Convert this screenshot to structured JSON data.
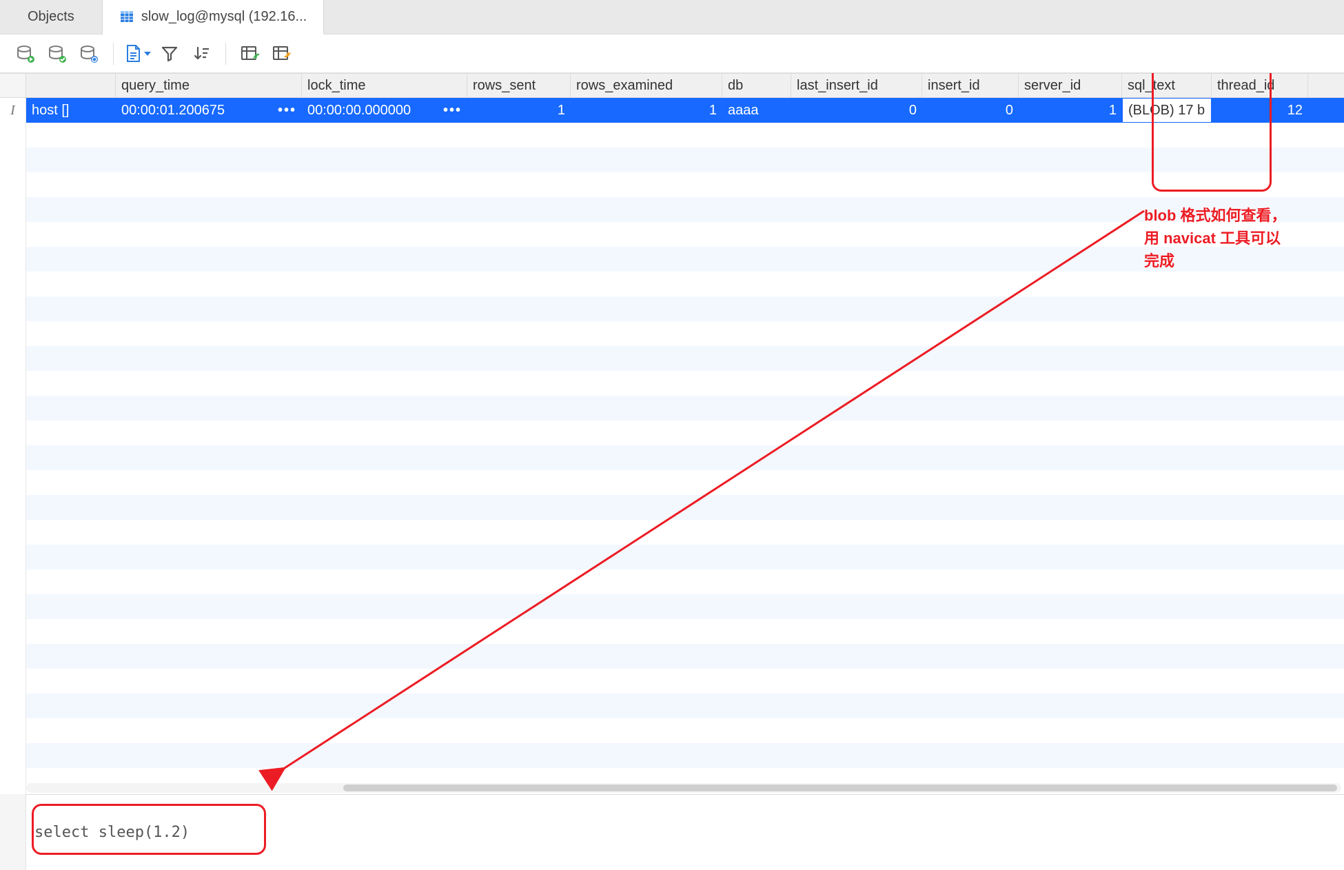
{
  "tabs": [
    {
      "label": "Objects"
    },
    {
      "label": "slow_log@mysql (192.16..."
    }
  ],
  "toolbar_icons": [
    "db-play-icon",
    "db-check-icon",
    "db-refresh-icon",
    "sep",
    "doc-icon",
    "filter-icon",
    "sort-icon",
    "sep",
    "table-import-icon",
    "table-export-icon"
  ],
  "columns": [
    {
      "key": "user_host",
      "label": "",
      "cls": "c-usr"
    },
    {
      "key": "query_time",
      "label": "query_time",
      "cls": "c-qt"
    },
    {
      "key": "lock_time",
      "label": "lock_time",
      "cls": "c-lt"
    },
    {
      "key": "rows_sent",
      "label": "rows_sent",
      "cls": "c-rs"
    },
    {
      "key": "rows_examined",
      "label": "rows_examined",
      "cls": "c-re"
    },
    {
      "key": "db",
      "label": "db",
      "cls": "c-db"
    },
    {
      "key": "last_insert_id",
      "label": "last_insert_id",
      "cls": "c-li"
    },
    {
      "key": "insert_id",
      "label": "insert_id",
      "cls": "c-ii"
    },
    {
      "key": "server_id",
      "label": "server_id",
      "cls": "c-si"
    },
    {
      "key": "sql_text",
      "label": "sql_text",
      "cls": "c-st"
    },
    {
      "key": "thread_id",
      "label": "thread_id",
      "cls": "c-ti"
    }
  ],
  "rows": [
    {
      "user_host": "host []",
      "query_time": "00:00:01.200675",
      "qt_dots": "•••",
      "lock_time": "00:00:00.000000",
      "lt_dots": "•••",
      "rows_sent": "1",
      "rows_examined": "1",
      "db": "aaaa",
      "last_insert_id": "0",
      "insert_id": "0",
      "server_id": "1",
      "sql_text": "(BLOB) 17 b",
      "thread_id": "12"
    }
  ],
  "annotation": {
    "line1": "blob 格式如何查看，",
    "line2": "用 navicat 工具可以",
    "line3": "完成"
  },
  "detail_sql": "select sleep(1.2)",
  "row_gutter_glyph": "I"
}
